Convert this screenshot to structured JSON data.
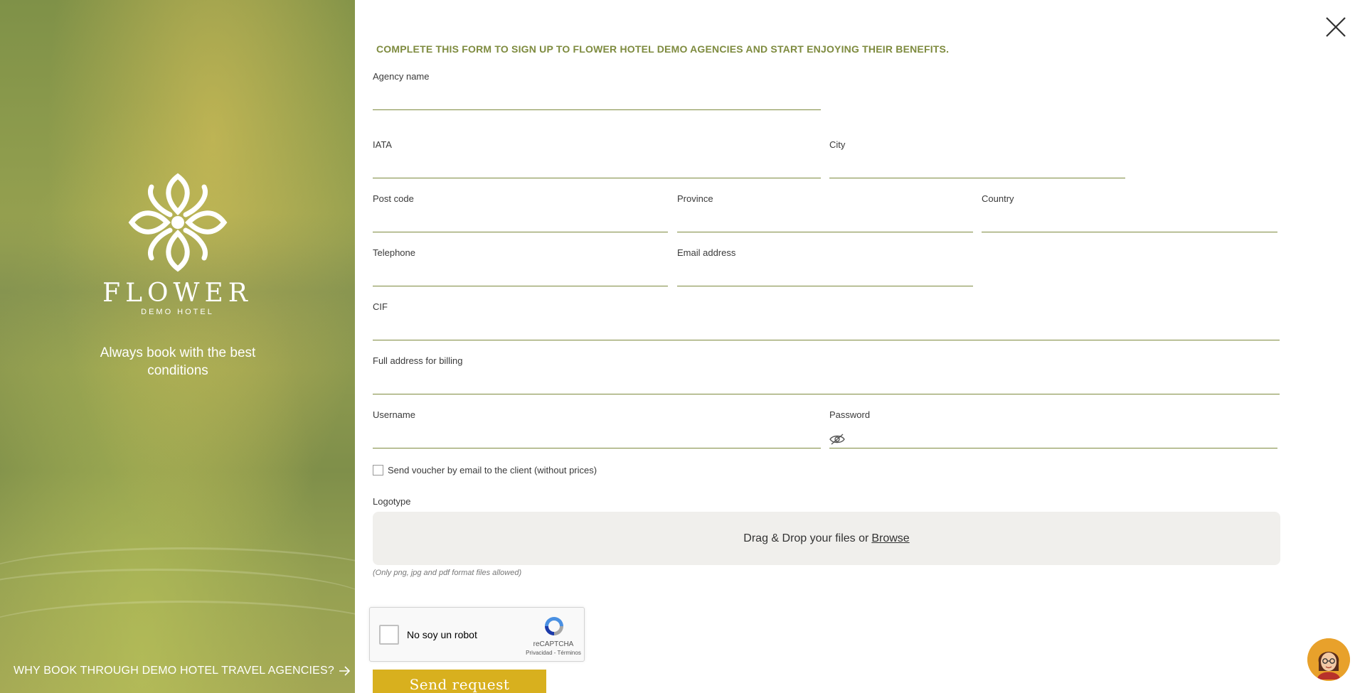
{
  "brand": {
    "name": "FLOWER",
    "subtitle": "DEMO HOTEL",
    "tagline": "Always book with the best conditions",
    "why_link": "WHY BOOK THROUGH DEMO HOTEL TRAVEL AGENCIES?"
  },
  "form": {
    "title": "COMPLETE THIS FORM TO SIGN UP TO FLOWER HOTEL DEMO AGENCIES AND START ENJOYING THEIR BENEFITS.",
    "fields": {
      "agency_name": "Agency name",
      "iata": "IATA",
      "city": "City",
      "post_code": "Post code",
      "province": "Province",
      "country": "Country",
      "telephone": "Telephone",
      "email": "Email address",
      "cif": "CIF",
      "billing_address": "Full address for billing",
      "username": "Username",
      "password": "Password"
    },
    "voucher_checkbox": "Send voucher by email to the client (without prices)",
    "logotype_label": "Logotype",
    "dropzone_text": "Drag & Drop your files or",
    "dropzone_browse": "Browse",
    "file_note": "(Only png, jpg and pdf format files allowed)",
    "submit_label": "Send request"
  },
  "recaptcha": {
    "label": "No soy un robot",
    "brand": "reCAPTCHA",
    "terms": "Privacidad - Términos"
  },
  "colors": {
    "accent": "#7e8b3f",
    "button": "#d8b01e",
    "panel": "#8b9a4c"
  },
  "icons": {
    "close": "close-icon",
    "eye": "eye-slash-icon",
    "arrow": "arrow-right-icon",
    "chat": "chat-avatar-icon"
  }
}
